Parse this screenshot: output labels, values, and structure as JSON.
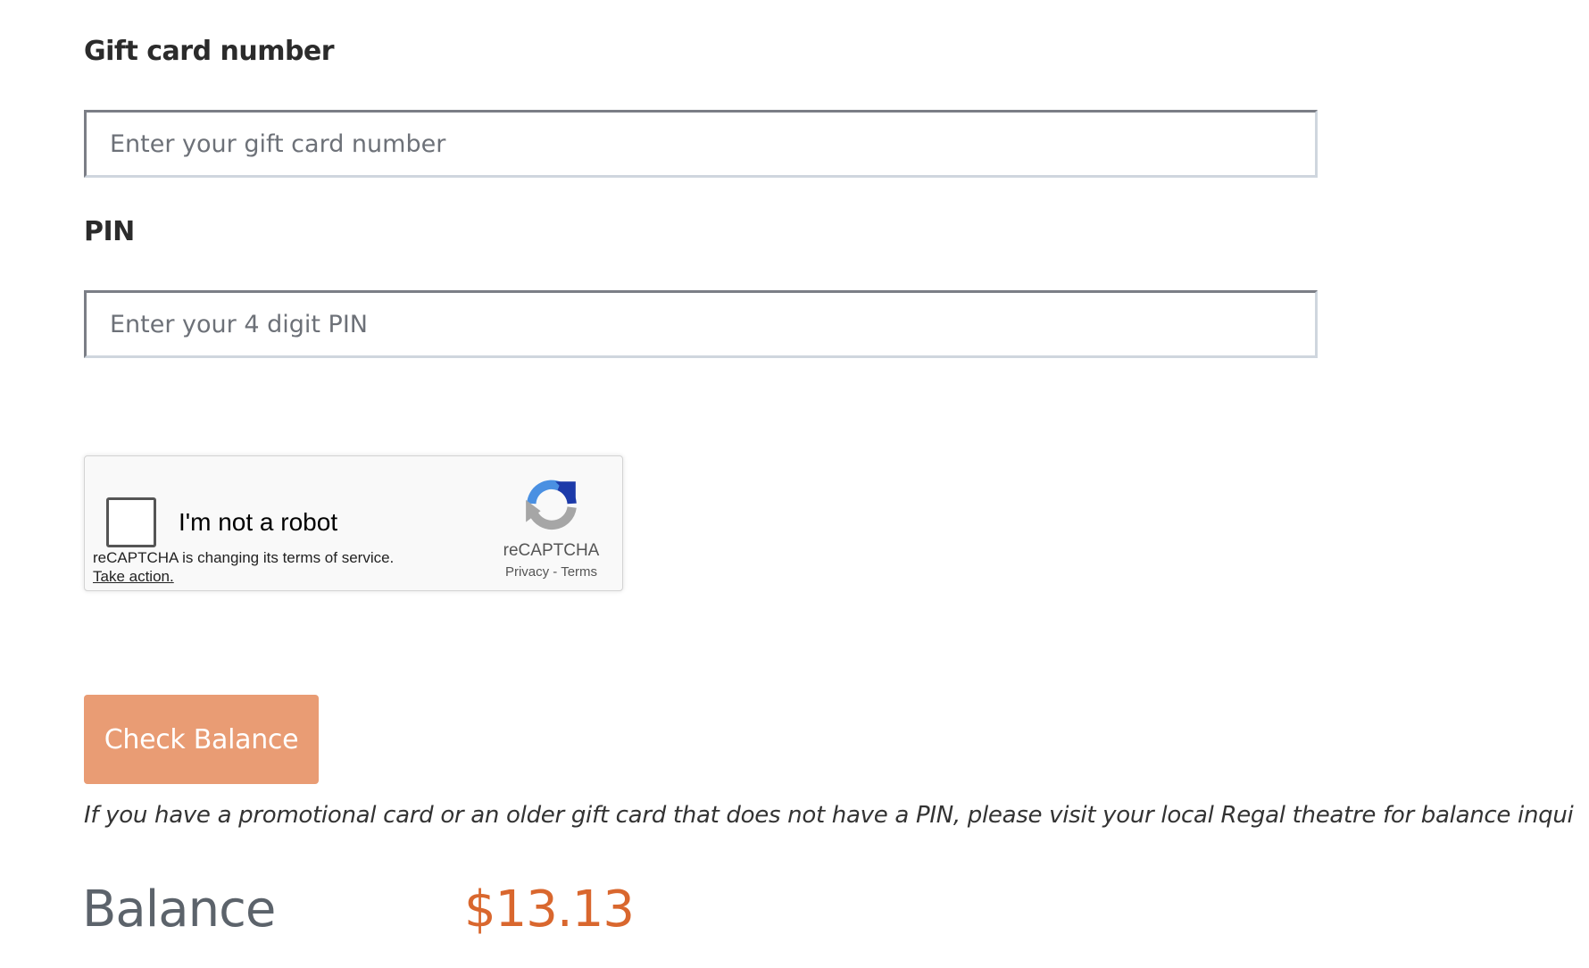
{
  "form": {
    "card_number": {
      "label": "Gift card number",
      "placeholder": "Enter your gift card number",
      "value": ""
    },
    "pin": {
      "label": "PIN",
      "placeholder": "Enter your 4 digit PIN",
      "value": ""
    }
  },
  "recaptcha": {
    "checkbox_label": "I'm not a robot",
    "checked": false,
    "notice": "reCAPTCHA is changing its terms of service.",
    "action_link": "Take action.",
    "brand": "reCAPTCHA",
    "privacy_link": "Privacy",
    "separator": "-",
    "terms_link": "Terms",
    "icon": "recaptcha-logo-icon"
  },
  "actions": {
    "check_balance_label": "Check Balance",
    "button_color": "#e99c74"
  },
  "note": "If you have a promotional card or an older gift card that does not have a PIN, please visit your local Regal theatre for balance inqui",
  "balance": {
    "label": "Balance",
    "value": "$13.13",
    "value_color": "#d9672e"
  }
}
